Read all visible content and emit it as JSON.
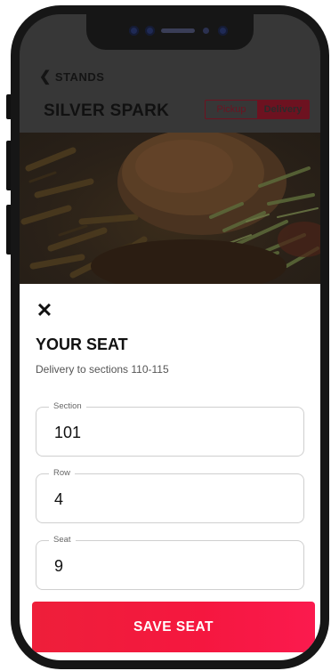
{
  "nav": {
    "back_label": "STANDS"
  },
  "stand": {
    "name": "SILVER SPARK",
    "toggle": {
      "options": [
        "Pickup",
        "Delivery"
      ],
      "selected": "Delivery"
    }
  },
  "seat_sheet": {
    "title": "YOUR SEAT",
    "subtitle": "Delivery to sections 110-115",
    "fields": [
      {
        "label": "Section",
        "value": "101"
      },
      {
        "label": "Row",
        "value": "4"
      },
      {
        "label": "Seat",
        "value": "9"
      }
    ],
    "save_label": "SAVE SEAT"
  },
  "colors": {
    "accent": "#f5173f",
    "overlay_accent": "#6d1220"
  }
}
